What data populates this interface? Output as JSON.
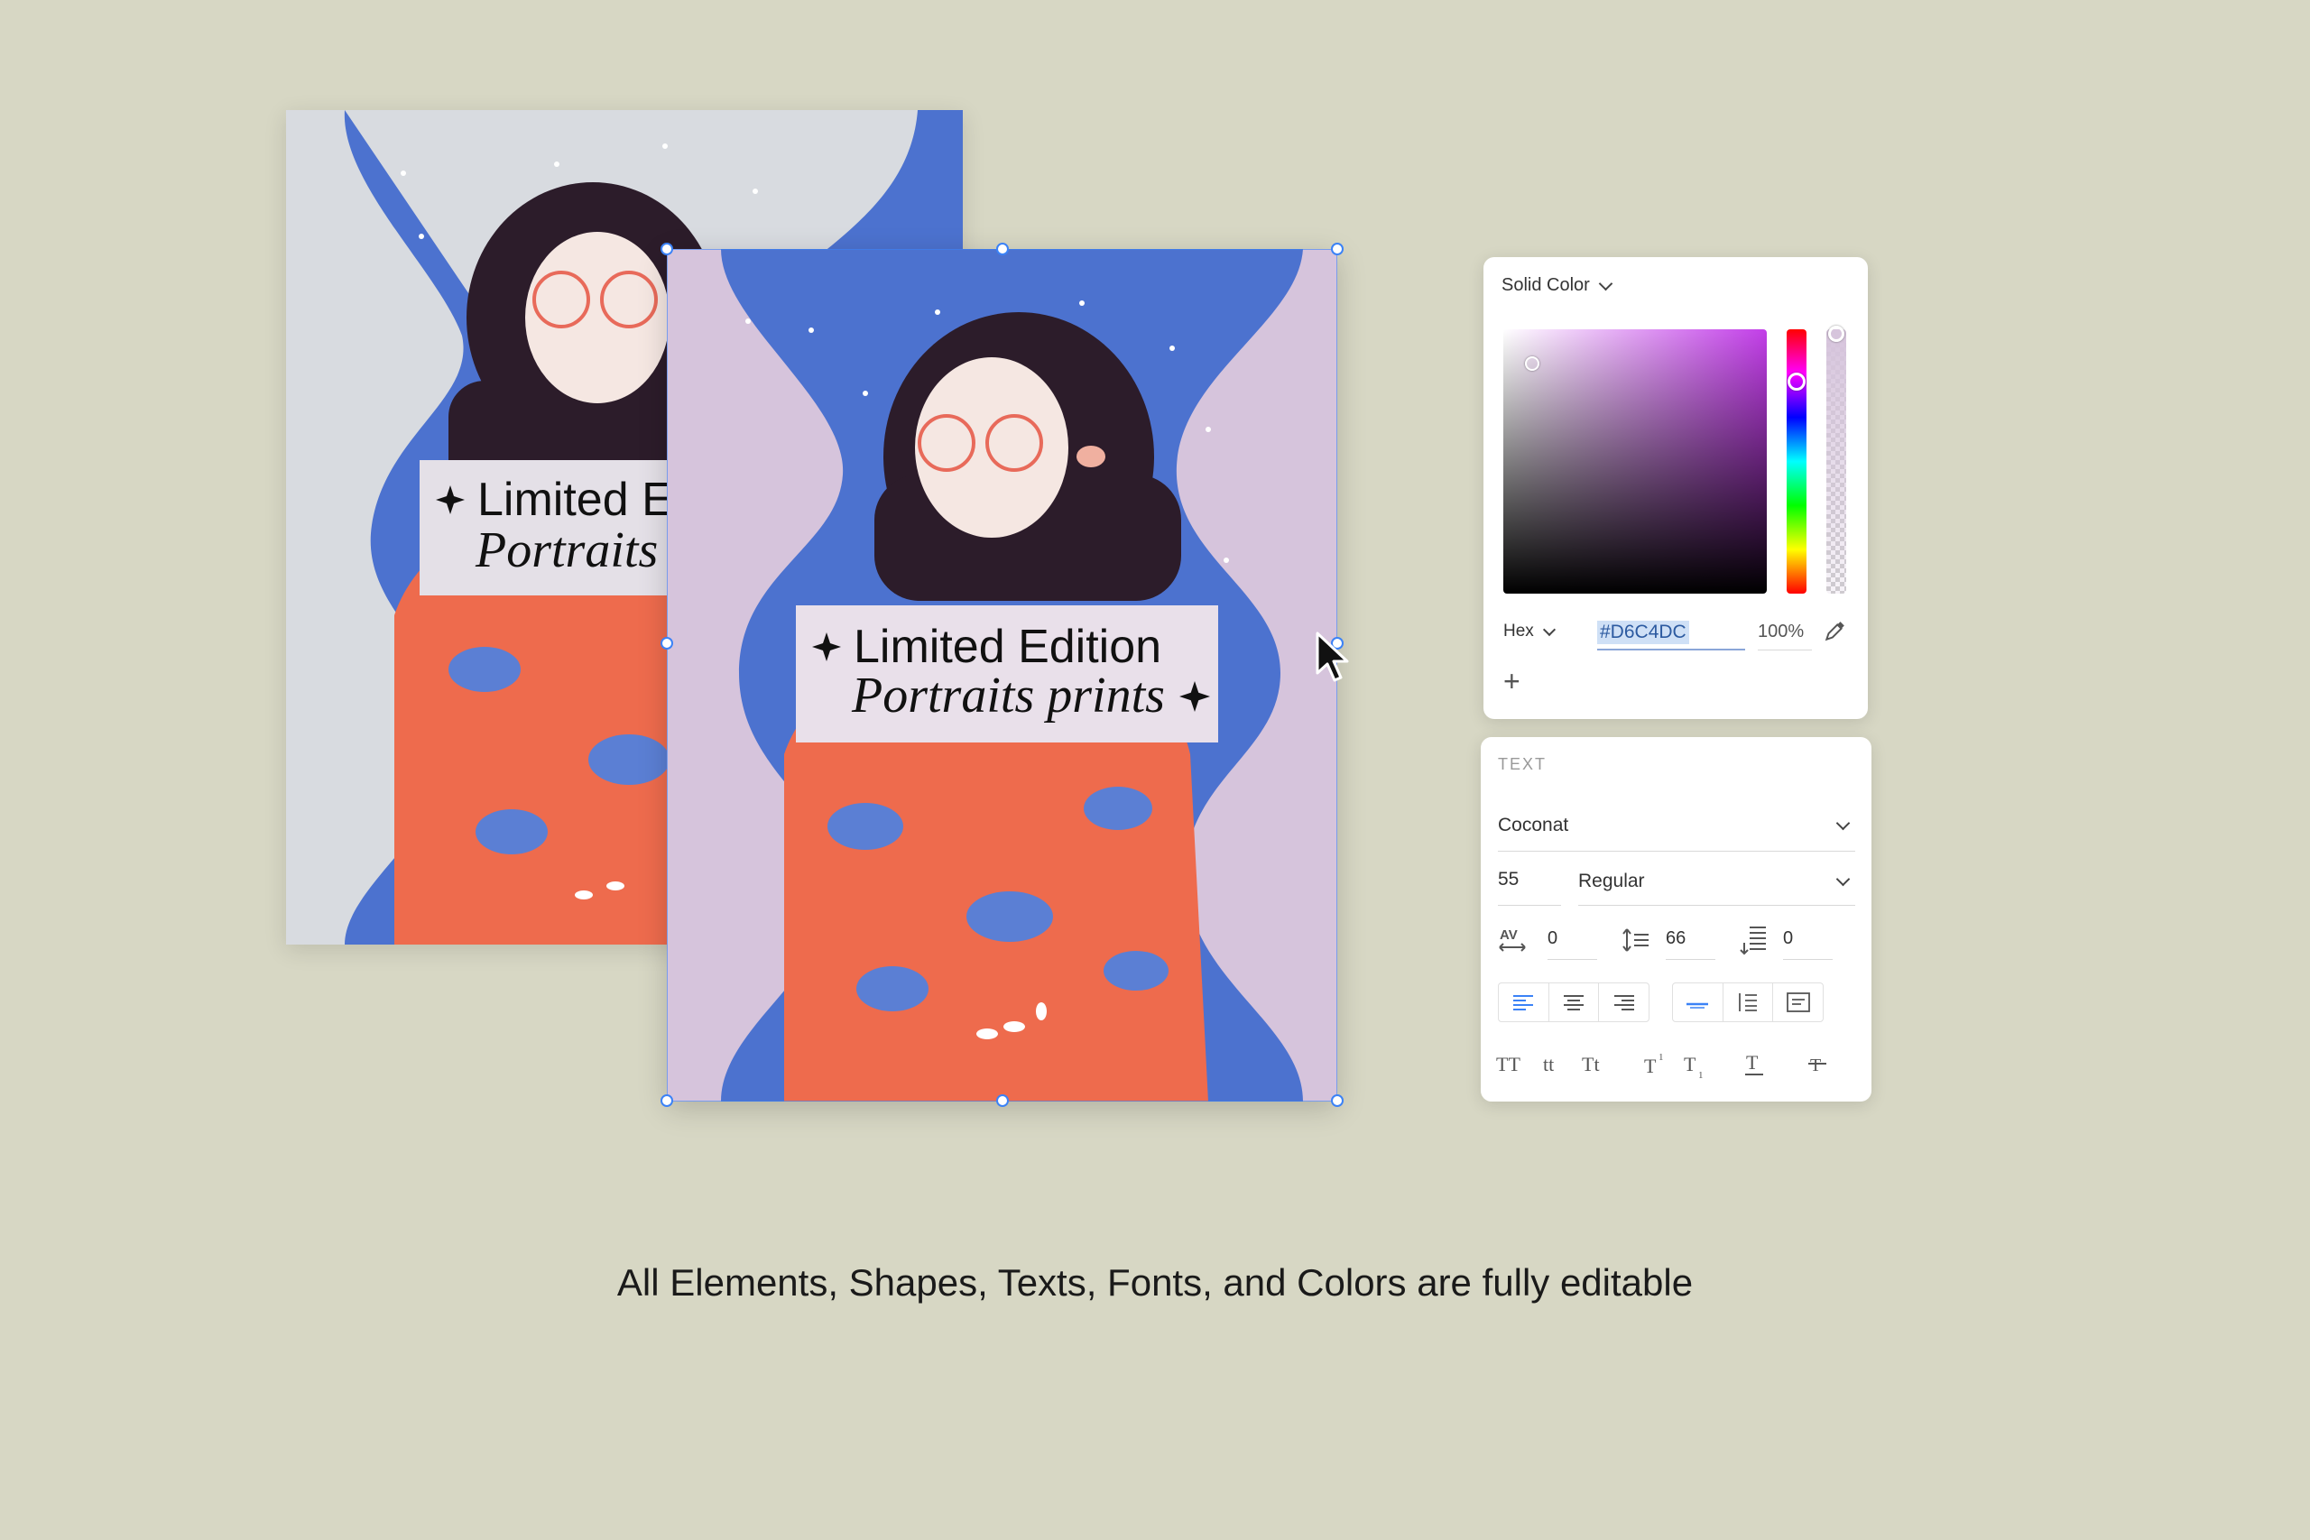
{
  "colors": {
    "background": "#d7d7c4",
    "blue": "#4c72cf",
    "lilac": "#d6c4dc",
    "grey_bg": "#d8dbe0",
    "orange": "#ee6b4d",
    "selection": "#3b82f6"
  },
  "posters": {
    "back": {
      "line1": "Limited Edition",
      "line2": "Portraits prints"
    },
    "front": {
      "line1": "Limited Edition",
      "line2": "Portraits prints"
    }
  },
  "color_panel": {
    "mode": "Solid Color",
    "format": "Hex",
    "hex_value": "#D6C4DC",
    "opacity": "100%",
    "add_label": "+",
    "icons": [
      "eyedropper-icon",
      "plus-icon",
      "chevron-down-icon"
    ]
  },
  "text_panel": {
    "section_title": "TEXT",
    "font_family": "Coconat",
    "font_size": "55",
    "font_weight": "Regular",
    "letter_spacing": "0",
    "line_height": "66",
    "paragraph_spacing": "0",
    "case_buttons": [
      "TT",
      "tt",
      "Tt"
    ],
    "icons": [
      "letter-spacing-icon",
      "line-height-icon",
      "paragraph-spacing-icon",
      "align-left-icon",
      "align-center-icon",
      "align-right-icon",
      "valign-top-icon",
      "valign-middle-icon",
      "valign-bottom-icon",
      "superscript-icon",
      "subscript-icon",
      "underline-icon",
      "strikethrough-icon"
    ]
  },
  "caption": "All Elements, Shapes, Texts, Fonts, and Colors are fully editable"
}
